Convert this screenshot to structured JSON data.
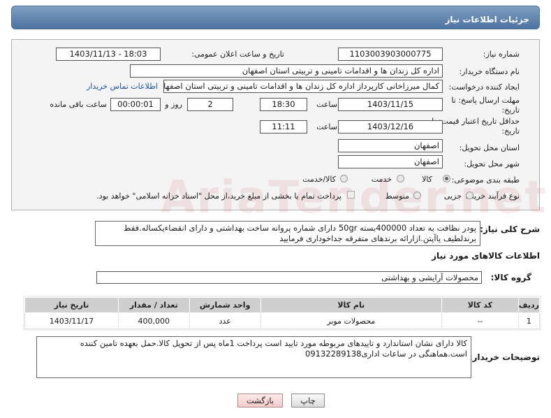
{
  "header": {
    "title": "جزئیات اطلاعات نیاز"
  },
  "labels": {
    "need_number": "شماره نیاز:",
    "announce_datetime": "تاریخ و ساعت اعلان عمومی:",
    "buyer_org": "نام دستگاه خریدار:",
    "request_creator": "ایجاد کننده درخواست:",
    "reply_deadline": "مهلت ارسال پاسخ: تا تاریخ:",
    "price_validity": "حداقل تاریخ اعتبار قیمت: تا تاریخ:",
    "time": "ساعت",
    "day_and": "روز و",
    "hours_remaining": "ساعت باقی مانده",
    "province": "استان محل تحویل:",
    "city": "شهر محل تحویل:",
    "category": "طبقه بندی موضوعی:",
    "purchase_type": "نوع فرآیند خرید :",
    "overall_desc": "شرح کلی نیاز:",
    "goods_info": "اطلاعات کالاهای مورد نیاز",
    "goods_group": "گروه کالا:",
    "buyer_notes": "توضیحات خریدار:"
  },
  "values": {
    "need_number": "1103003903000775",
    "announce_datetime": "1403/11/13 - 18:03",
    "buyer_org": "اداره کل زندان ها و اقدامات تامینی و تربیتی استان اصفهان",
    "request_creator": "کمال میرزاخانی کارپرداز اداره کل زندان ها و اقدامات تامینی و تربیتی استان اصفهان",
    "contact_link": "اطلاعات تماس خریدار",
    "reply_date": "1403/11/15",
    "reply_time": "18:30",
    "days": "2",
    "remaining": "00:00:01",
    "validity_date": "1403/12/16",
    "validity_time": "11:11",
    "province": "اصفهان",
    "city": "اصفهان",
    "category_options": [
      "کالا",
      "خدمت",
      "کالا/خدمت"
    ],
    "purchase_options": [
      "جزیی",
      "متوسط"
    ],
    "payment_note": "پرداخت تمام یا بخشی از مبلغ خرید،از محل \"اسناد خزانه اسلامی\" خواهد بود.",
    "overall_desc": "پودر نظافت به تعداد 400000بسته 50gr دارای شماره پروانه ساخت بهداشتی و دارای انقضاءیکساله.فقط برندلطیف یاآپتن.ازارائه برندهای متفرقه جداخوداری فرمایید",
    "goods_group": "محصولات آرایشی و بهداشتی",
    "buyer_notes": "کالا دارای نشان استاندارد و تاییدهای مربوطه مورد تایید است پرداخت 1ماه پس از تحویل کالا.حمل بعهده تامین کننده است.هماهنگی در ساعات اداری09132289138"
  },
  "table": {
    "headers": [
      "ردیف",
      "کد کالا",
      "نام کالا",
      "واحد شمارش",
      "تعداد / مقدار",
      "تاریخ نیاز"
    ],
    "rows": [
      [
        "1",
        "--",
        "محصولات موبر",
        "عدد",
        "400,000",
        "1403/11/17"
      ]
    ]
  },
  "buttons": {
    "print": "چاپ",
    "back": "بازگشت"
  },
  "watermark": "AriaTender.net"
}
